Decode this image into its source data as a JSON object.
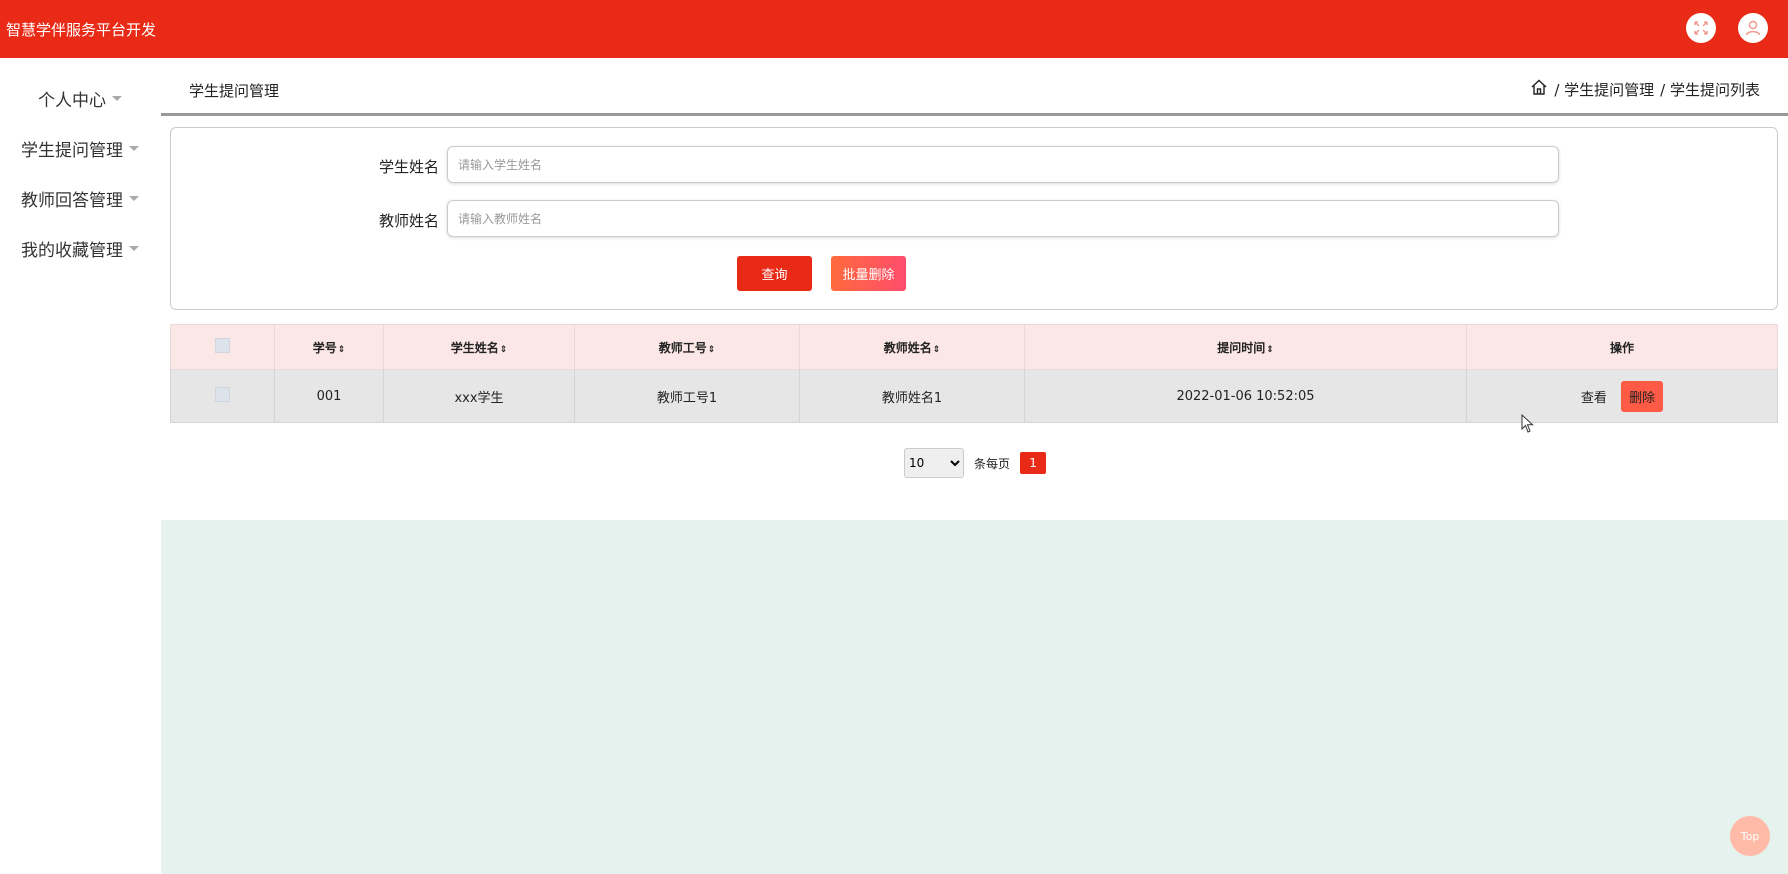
{
  "header": {
    "app_title": "智慧学伴服务平台开发"
  },
  "sidebar": {
    "items": [
      {
        "label": "个人中心"
      },
      {
        "label": "学生提问管理"
      },
      {
        "label": "教师回答管理"
      },
      {
        "label": "我的收藏管理"
      }
    ]
  },
  "page": {
    "title": "学生提问管理",
    "breadcrumb": [
      "/ 学生提问管理",
      "/ 学生提问列表"
    ]
  },
  "search": {
    "student_label": "学生姓名",
    "student_placeholder": "请输入学生姓名",
    "teacher_label": "教师姓名",
    "teacher_placeholder": "请输入教师姓名",
    "query_button": "查询",
    "batch_delete_button": "批量删除"
  },
  "table": {
    "headers": [
      "学号",
      "学生姓名",
      "教师工号",
      "教师姓名",
      "提问时间",
      "操作"
    ],
    "rows": [
      {
        "student_no": "001",
        "student_name": "xxx学生",
        "teacher_no": "教师工号1",
        "teacher_name": "教师姓名1",
        "time": "2022-01-06 10:52:05",
        "view_label": "查看",
        "delete_label": "删除"
      }
    ]
  },
  "pagination": {
    "page_size": "10",
    "page_size_options": [
      "10"
    ],
    "per_page_label": "条每页",
    "current_page": "1"
  },
  "back_to_top": "Top",
  "colors": {
    "primary": "#e92a17",
    "header_row": "#fbe7e5",
    "footer_bg": "#e6f2ed"
  }
}
